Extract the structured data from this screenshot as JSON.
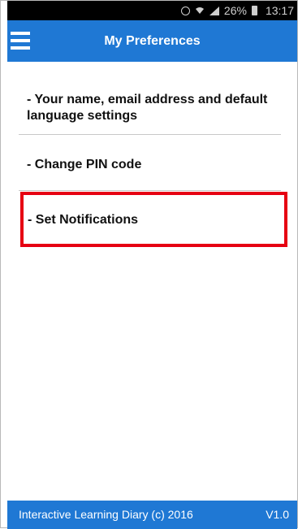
{
  "status_bar": {
    "battery_percent": "26%",
    "time": "13:17",
    "icons": [
      "alarm-icon",
      "wifi-icon",
      "signal-icon",
      "battery-icon"
    ]
  },
  "header": {
    "title": "My Preferences",
    "menu_icon": "hamburger-menu-icon"
  },
  "preferences": {
    "items": [
      {
        "label": "- Your name, email address and default language settings"
      },
      {
        "label": "- Change PIN code"
      },
      {
        "label": "- Set Notifications"
      }
    ]
  },
  "footer": {
    "app_label": "Interactive Learning Diary (c) 2016",
    "version": "V1.0"
  },
  "colors": {
    "accent": "#1f78d4",
    "highlight": "#e60012"
  }
}
